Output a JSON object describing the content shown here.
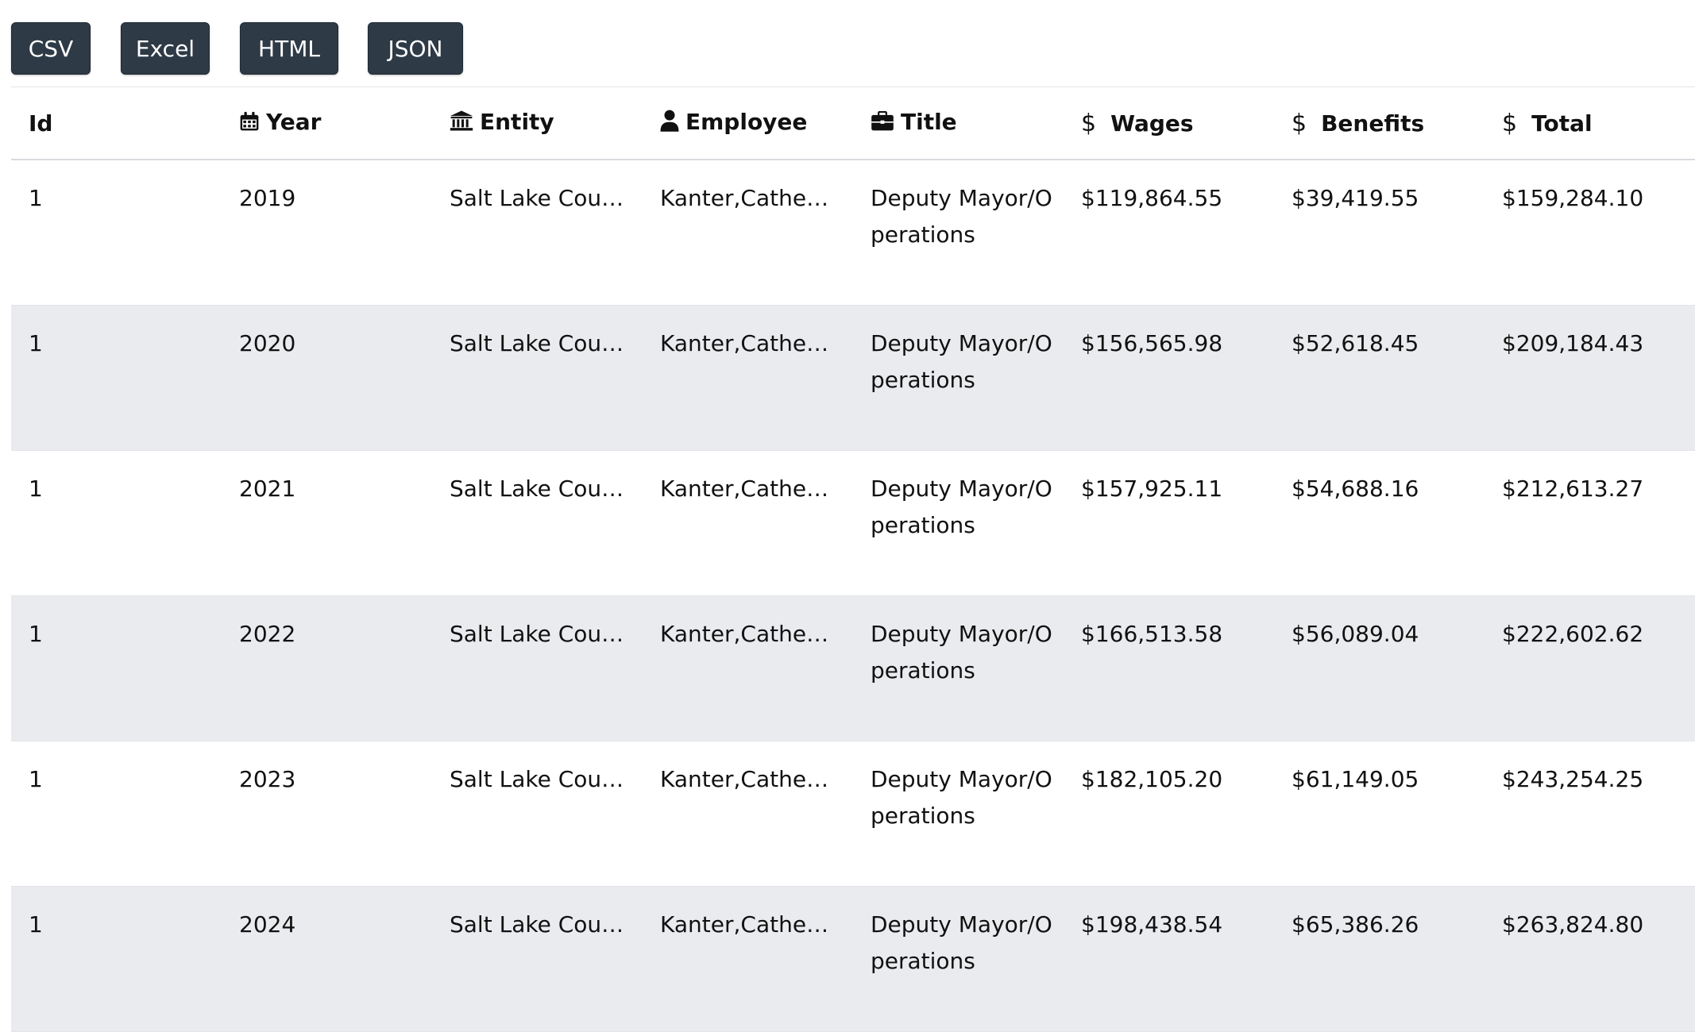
{
  "toolbar": {
    "buttons": [
      {
        "label": "CSV"
      },
      {
        "label": "Excel"
      },
      {
        "label": "HTML"
      },
      {
        "label": "JSON"
      }
    ]
  },
  "table": {
    "headers": {
      "id": "Id",
      "year": "Year",
      "entity": "Entity",
      "employee": "Employee",
      "title": "Title",
      "wages": "Wages",
      "benefits": "Benefits",
      "total": "Total"
    },
    "header_icons": {
      "year": "calendar-icon",
      "entity": "bank-icon",
      "employee": "user-icon",
      "title": "briefcase-icon",
      "wages": "dollar-icon",
      "benefits": "dollar-icon",
      "total": "dollar-icon"
    },
    "rows": [
      {
        "id": "1",
        "year": "2019",
        "entity": "Salt Lake County",
        "employee": "Kanter,Catherine",
        "title": "Deputy Mayor/Operations",
        "wages": "$119,864.55",
        "benefits": "$39,419.55",
        "total": "$159,284.10"
      },
      {
        "id": "1",
        "year": "2020",
        "entity": "Salt Lake County",
        "employee": "Kanter,Catherine",
        "title": "Deputy Mayor/Operations",
        "wages": "$156,565.98",
        "benefits": "$52,618.45",
        "total": "$209,184.43"
      },
      {
        "id": "1",
        "year": "2021",
        "entity": "Salt Lake County",
        "employee": "Kanter,Catherine",
        "title": "Deputy Mayor/Operations",
        "wages": "$157,925.11",
        "benefits": "$54,688.16",
        "total": "$212,613.27"
      },
      {
        "id": "1",
        "year": "2022",
        "entity": "Salt Lake County",
        "employee": "Kanter,Catherine",
        "title": "Deputy Mayor/Operations",
        "wages": "$166,513.58",
        "benefits": "$56,089.04",
        "total": "$222,602.62"
      },
      {
        "id": "1",
        "year": "2023",
        "entity": "Salt Lake County",
        "employee": "Kanter,Catherine",
        "title": "Deputy Mayor/Operations",
        "wages": "$182,105.20",
        "benefits": "$61,149.05",
        "total": "$243,254.25"
      },
      {
        "id": "1",
        "year": "2024",
        "entity": "Salt Lake County",
        "employee": "Kanter,Catherine",
        "title": "Deputy Mayor/Operations",
        "wages": "$198,438.54",
        "benefits": "$65,386.26",
        "total": "$263,824.80"
      }
    ]
  },
  "colors": {
    "button_bg": "#2e3a46",
    "button_text": "#ffffff",
    "row_alt_bg": "#eaebee",
    "border": "#e3e5e8"
  }
}
